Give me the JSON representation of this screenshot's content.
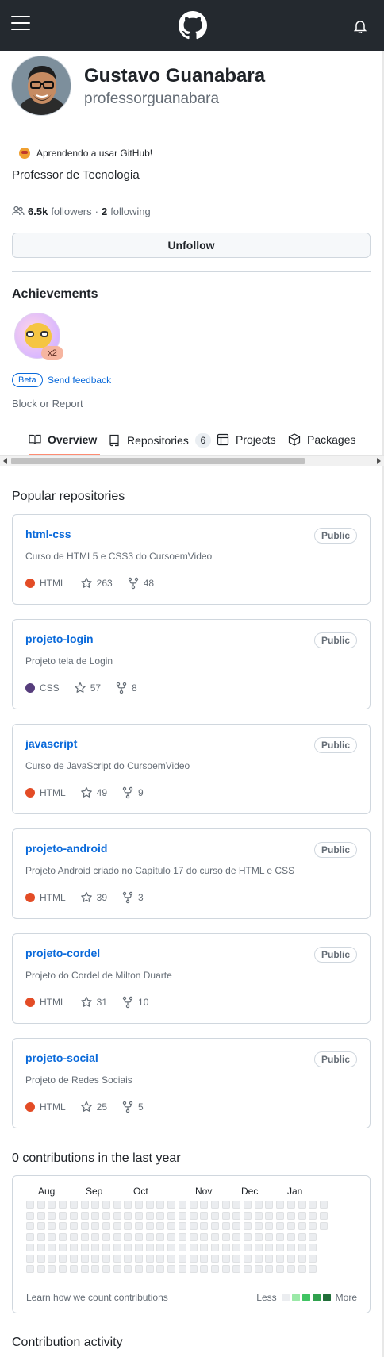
{
  "header": {
    "logo": "github-mark-icon"
  },
  "profile": {
    "name": "Gustavo Guanabara",
    "login": "professorguanabara",
    "status": "Aprendendo a usar GitHub!",
    "bio": "Professor de Tecnologia",
    "followers_count": "6.5k",
    "followers_label": "followers",
    "separator": "·",
    "following_count": "2",
    "following_label": "following",
    "unfollow_label": "Unfollow"
  },
  "achievements": {
    "title": "Achievements",
    "badge_multiplier": "x2",
    "beta_label": "Beta",
    "feedback_label": "Send feedback"
  },
  "block_label": "Block or Report",
  "tabs": [
    {
      "label": "Overview",
      "icon": "book-icon"
    },
    {
      "label": "Repositories",
      "icon": "repo-icon",
      "count": "6"
    },
    {
      "label": "Projects",
      "icon": "table-icon"
    },
    {
      "label": "Packages",
      "icon": "package-icon"
    }
  ],
  "popular": {
    "title": "Popular repositories",
    "repos": [
      {
        "name": "html-css",
        "visibility": "Public",
        "description": "Curso de HTML5 e CSS3 do CursoemVideo",
        "language": "HTML",
        "language_color": "#e34c26",
        "stars": "263",
        "forks": "48"
      },
      {
        "name": "projeto-login",
        "visibility": "Public",
        "description": "Projeto tela de Login",
        "language": "CSS",
        "language_color": "#563d7c",
        "stars": "57",
        "forks": "8"
      },
      {
        "name": "javascript",
        "visibility": "Public",
        "description": "Curso de JavaScript do CursoemVideo",
        "language": "HTML",
        "language_color": "#e34c26",
        "stars": "49",
        "forks": "9"
      },
      {
        "name": "projeto-android",
        "visibility": "Public",
        "description": "Projeto Android criado no Capítulo 17 do curso de HTML e CSS",
        "language": "HTML",
        "language_color": "#e34c26",
        "stars": "39",
        "forks": "3"
      },
      {
        "name": "projeto-cordel",
        "visibility": "Public",
        "description": "Projeto do Cordel de Milton Duarte",
        "language": "HTML",
        "language_color": "#e34c26",
        "stars": "31",
        "forks": "10"
      },
      {
        "name": "projeto-social",
        "visibility": "Public",
        "description": "Projeto de Redes Sociais",
        "language": "HTML",
        "language_color": "#e34c26",
        "stars": "25",
        "forks": "5"
      }
    ]
  },
  "contributions": {
    "title": "0 contributions in the last year",
    "months": [
      "Aug",
      "Sep",
      "Oct",
      "Nov",
      "Dec",
      "Jan"
    ],
    "learn_label": "Learn how we count contributions",
    "legend_less": "Less",
    "legend_more": "More",
    "legend_colors": [
      "#ebedf0",
      "#9be9a8",
      "#40c463",
      "#30a14e",
      "#216e39"
    ]
  },
  "activity_title": "Contribution activity"
}
